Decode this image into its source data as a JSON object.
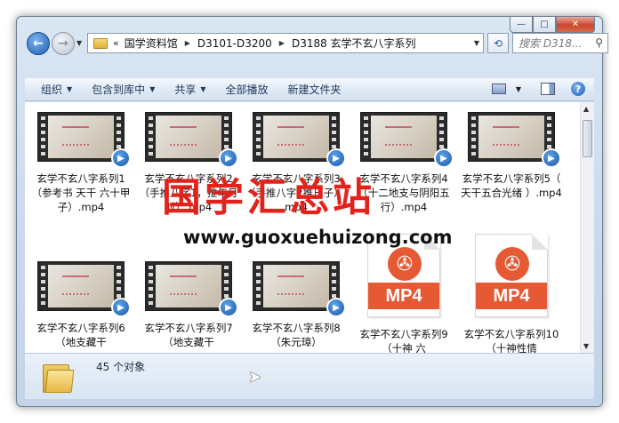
{
  "window": {
    "minimize_glyph": "—",
    "maximize_glyph": "□",
    "close_glyph": "✕"
  },
  "nav": {
    "back_glyph": "←",
    "forward_glyph": "→",
    "chevrons": "«",
    "breadcrumbs": [
      "国学资料馆",
      "D3101-D3200",
      "D3188 玄学不玄八字系列"
    ],
    "search_placeholder": "搜索 D318...",
    "refresh_glyph": "⟲"
  },
  "toolbar": {
    "items": [
      "组织",
      "包含到库中",
      "共享",
      "全部播放",
      "新建文件夹"
    ],
    "has_caret": [
      true,
      true,
      true,
      false,
      false
    ],
    "help_glyph": "?"
  },
  "files": [
    {
      "name": "玄学不玄八字系列1（参考书 天干 六十甲子）.mp4",
      "kind": "video"
    },
    {
      "name": "玄学不玄八字系列2（手推八字1，推年月时）.mp4",
      "kind": "video"
    },
    {
      "name": "玄学不玄八字系列3（手推八字2推日子）.mp4",
      "kind": "video"
    },
    {
      "name": "玄学不玄八字系列4（十二地支与阴阳五行）.mp4",
      "kind": "video"
    },
    {
      "name": "玄学不玄八字系列5（ 天干五合光绪 ）.mp4",
      "kind": "video"
    },
    {
      "name": "玄学不玄八字系列6（地支藏干",
      "kind": "video"
    },
    {
      "name": "玄学不玄八字系列7（地支藏干",
      "kind": "video"
    },
    {
      "name": "玄学不玄八字系列8（朱元璋）",
      "kind": "video"
    },
    {
      "name": "玄学不玄八字系列9（十神 六",
      "kind": "mp4"
    },
    {
      "name": "玄学不玄八字系列10（十神性情",
      "kind": "mp4"
    }
  ],
  "mp4_label": "MP4",
  "watermark": {
    "chinese": "国学汇总站",
    "url": "www.guoxuehuizong.com"
  },
  "details": {
    "count": "45 个对象"
  }
}
